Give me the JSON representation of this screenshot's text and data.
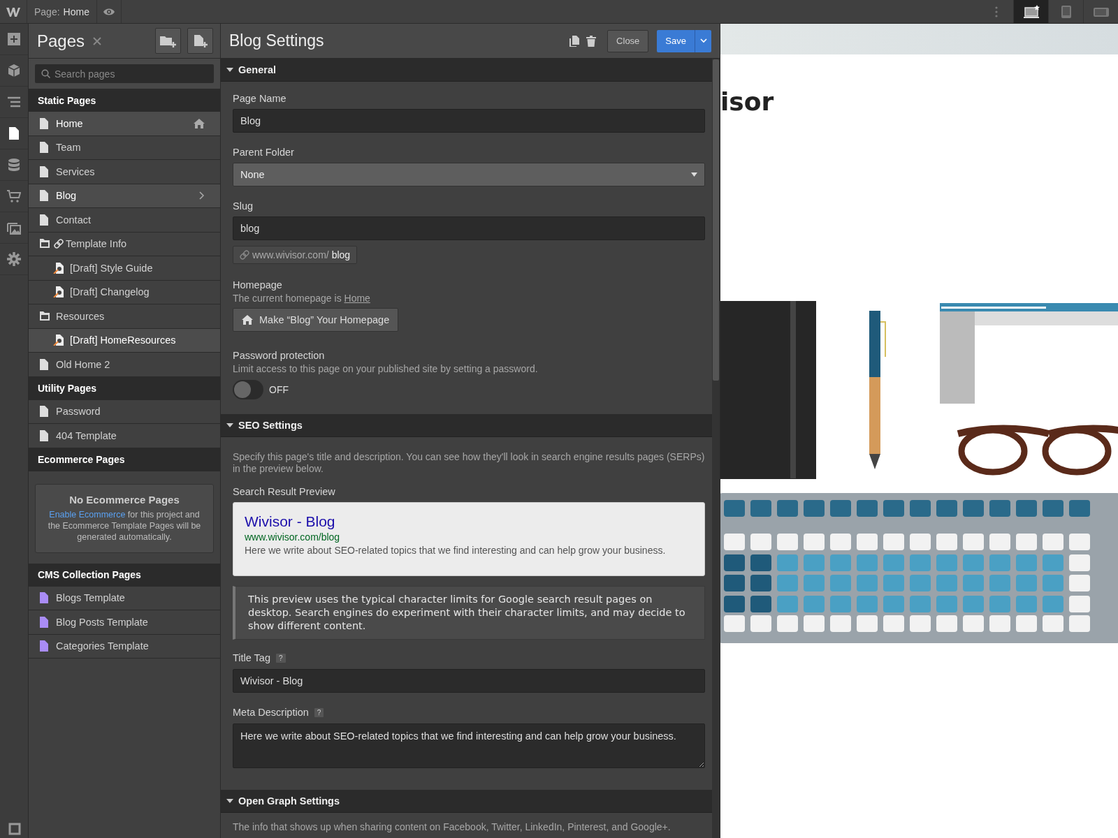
{
  "topbar": {
    "page_label": "Page:",
    "page_name": "Home",
    "devices": [
      {
        "kind": "desktop",
        "selected": true
      },
      {
        "kind": "tablet",
        "selected": false
      },
      {
        "kind": "landscape",
        "selected": false
      }
    ]
  },
  "rail": [
    {
      "kind": "add",
      "selected": false
    },
    {
      "kind": "cube",
      "selected": false
    },
    {
      "kind": "navigator",
      "selected": false
    },
    {
      "kind": "pages",
      "selected": true
    },
    {
      "kind": "database",
      "selected": false
    },
    {
      "kind": "cart",
      "selected": false
    },
    {
      "kind": "images",
      "selected": false
    },
    {
      "kind": "settings",
      "selected": false
    }
  ],
  "pages_panel": {
    "title": "Pages",
    "search": {
      "placeholder": "Search pages"
    },
    "sections": [
      {
        "title": "Static Pages",
        "items": [
          {
            "label": "Home",
            "kind": "page",
            "selected": true,
            "homepage": true,
            "open": false
          },
          {
            "label": "Team",
            "kind": "page",
            "selected": false,
            "homepage": false,
            "open": false
          },
          {
            "label": "Services",
            "kind": "page",
            "selected": false,
            "homepage": false,
            "open": false
          },
          {
            "label": "Blog",
            "kind": "page",
            "selected": true,
            "homepage": false,
            "open": true
          },
          {
            "label": "Contact",
            "kind": "page",
            "selected": false,
            "homepage": false,
            "open": false
          },
          {
            "label": "Template Info",
            "kind": "linked-folder",
            "selected": false,
            "homepage": false,
            "open": false,
            "children": [
              {
                "label": "[Draft] Style Guide",
                "kind": "draft",
                "selected": false,
                "homepage": false,
                "open": false
              },
              {
                "label": "[Draft] Changelog",
                "kind": "draft",
                "selected": false,
                "homepage": false,
                "open": false
              }
            ]
          },
          {
            "label": "Resources",
            "kind": "folder",
            "selected": false,
            "homepage": false,
            "open": false,
            "children": [
              {
                "label": "[Draft] HomeResources",
                "kind": "draft",
                "selected": true,
                "homepage": false,
                "open": false
              }
            ]
          },
          {
            "label": "Old Home 2",
            "kind": "page",
            "selected": false,
            "homepage": false,
            "open": false
          }
        ]
      },
      {
        "title": "Utility Pages",
        "items": [
          {
            "label": "Password",
            "kind": "page",
            "selected": false,
            "homepage": false,
            "open": false
          },
          {
            "label": "404 Template",
            "kind": "page",
            "selected": false,
            "homepage": false,
            "open": false
          }
        ]
      },
      {
        "title": "Ecommerce Pages",
        "empty": {
          "title": "No Ecommerce Pages",
          "link": "Enable Ecommerce",
          "text": " for this project and the Ecommerce Template Pages will be generated automatically."
        }
      },
      {
        "title": "CMS Collection Pages",
        "items": [
          {
            "label": "Blogs Template",
            "kind": "cms",
            "selected": false,
            "homepage": false,
            "open": false
          },
          {
            "label": "Blog Posts Template",
            "kind": "cms",
            "selected": false,
            "homepage": false,
            "open": false
          },
          {
            "label": "Categories Template",
            "kind": "cms",
            "selected": false,
            "homepage": false,
            "open": false
          }
        ]
      }
    ]
  },
  "settings": {
    "title": "Blog Settings",
    "close": "Close",
    "save": "Save",
    "general": {
      "title": "General",
      "expanded": true,
      "page_name": {
        "label": "Page Name",
        "value": "Blog"
      },
      "parent_folder": {
        "label": "Parent Folder",
        "value": "None"
      },
      "slug": {
        "label": "Slug",
        "value": "blog"
      },
      "url": {
        "base": "www.wivisor.com/",
        "slug": "blog"
      },
      "homepage": {
        "label": "Homepage",
        "text": "The current homepage is ",
        "link": "Home",
        "button": "Make “Blog” Your Homepage"
      },
      "password": {
        "label": "Password protection",
        "text": "Limit access to this page on your published site by setting a password.",
        "on": false,
        "state_text": "OFF"
      }
    },
    "seo": {
      "title": "SEO Settings",
      "expanded": true,
      "intro": "Specify this page's title and description. You can see how they'll look in search engine results pages (SERPs) in the preview below.",
      "preview_label": "Search Result Preview",
      "preview": {
        "title": "Wivisor - Blog",
        "url": "www.wivisor.com/blog",
        "description": "Here we write about SEO-related topics that we find interesting and can help grow your business."
      },
      "note": "This preview uses the typical character limits for Google search result pages on desktop. Search engines do experiment with their character limits, and may decide to show different content.",
      "title_tag": {
        "label": "Title Tag",
        "help": "?",
        "value": "Wivisor - Blog"
      },
      "meta_description": {
        "label": "Meta Description",
        "help": "?",
        "value": "Here we write about SEO-related topics that we find interesting and can help grow your business."
      }
    },
    "open_graph": {
      "title": "Open Graph Settings",
      "expanded": true,
      "intro": "The info that shows up when sharing content on Facebook, Twitter, LinkedIn, Pinterest, and Google+."
    }
  },
  "preview": {
    "logo": "isor"
  }
}
